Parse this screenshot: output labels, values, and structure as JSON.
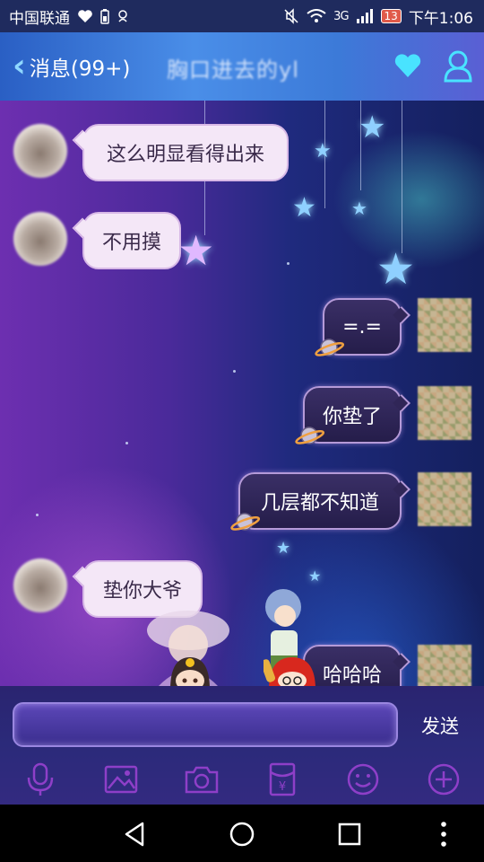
{
  "status_bar": {
    "carrier": "中国联通",
    "battery": "13",
    "network": "3G",
    "time": "下午1:06"
  },
  "header": {
    "back_label": "消息(99+)",
    "title": "胸口进去的yl"
  },
  "messages": [
    {
      "side": "in",
      "text": "这么明显看得出来"
    },
    {
      "side": "in",
      "text": "不用摸"
    },
    {
      "side": "out",
      "text": "=.="
    },
    {
      "side": "out",
      "text": "你垫了"
    },
    {
      "side": "out",
      "text": "几层都不知道"
    },
    {
      "side": "in",
      "text": "垫你大爷"
    },
    {
      "side": "out",
      "text": "哈哈哈"
    }
  ],
  "input": {
    "value": "",
    "send_label": "发送"
  },
  "toolbar": {
    "icons": [
      "microphone-icon",
      "image-icon",
      "camera-icon",
      "red-packet-icon",
      "emoji-icon",
      "plus-icon"
    ],
    "red_packet_glyph": "¥"
  },
  "colors": {
    "header": "#3c7ad8",
    "incoming_bubble": "#f4e7f7",
    "outgoing_bubble": "#2b2255",
    "toolbar_icon": "#8e3fc8",
    "status_bar": "#1f2b5e"
  }
}
